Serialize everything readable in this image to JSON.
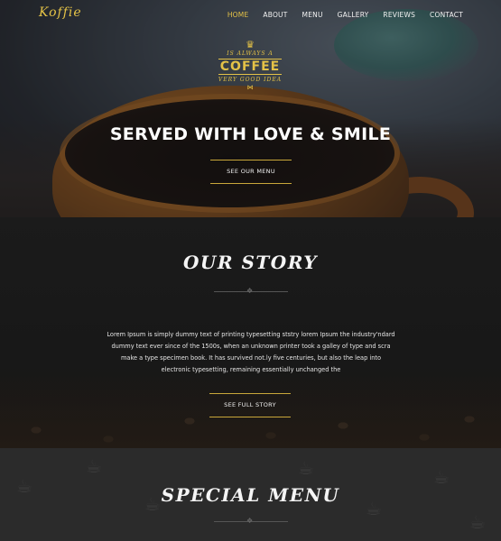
{
  "brand": {
    "logo": "Koffie"
  },
  "nav": {
    "items": [
      {
        "label": "HOME",
        "active": true
      },
      {
        "label": "ABOUT",
        "active": false
      },
      {
        "label": "MENU",
        "active": false
      },
      {
        "label": "GALLERY",
        "active": false
      },
      {
        "label": "REVIEWS",
        "active": false
      },
      {
        "label": "CONTACT",
        "active": false
      }
    ]
  },
  "hero": {
    "badge": {
      "line1": "IS ALWAYS A",
      "line2": "COFFEE",
      "line3": "VERY GOOD IDEA"
    },
    "title": "SERVED WITH LOVE & SMILE",
    "button": "SEE OUR MENU"
  },
  "story": {
    "title": "OUR STORY",
    "text": "Lorem Ipsum is simply dummy text of printing typesetting ststry lorem Ipsum the industry'ndard dummy text ever since of the 1500s, when an unknown printer took a galley of type and scra make a type specimen book. It has survived not.ly five centuries, but also the leap into electronic typesetting, remaining essentially unchanged the",
    "button": "SEE FULL STORY"
  },
  "special_menu": {
    "title": "SPECIAL MENU"
  },
  "colors": {
    "accent": "#e4c247",
    "dark": "#1b1b1b",
    "panel": "#2b2b2b"
  },
  "icons": [
    "crown-icon",
    "bowtie-icon",
    "divider-ornament-icon",
    "coffee-doodle-icon"
  ]
}
